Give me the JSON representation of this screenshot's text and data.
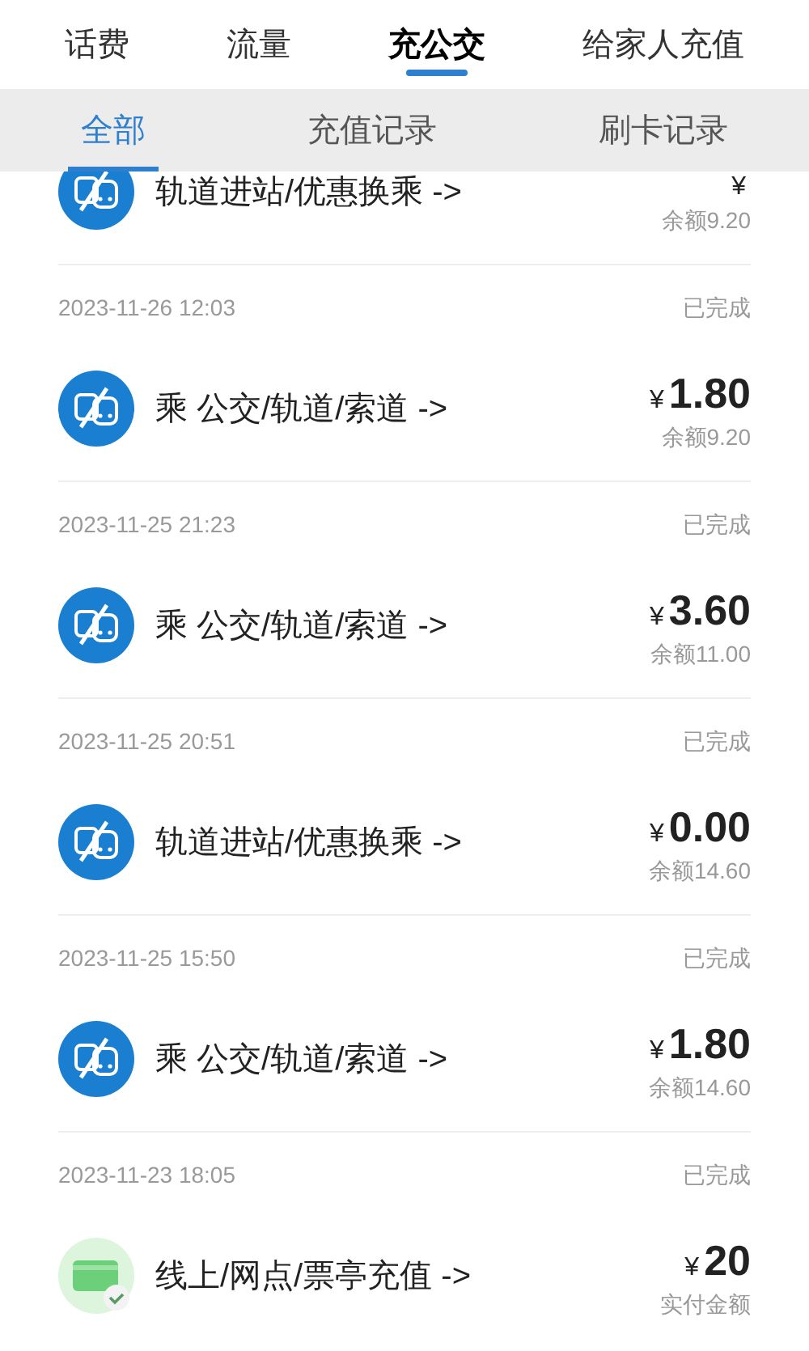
{
  "top_tabs": [
    {
      "label": "话费",
      "selected": false
    },
    {
      "label": "流量",
      "selected": false
    },
    {
      "label": "充公交",
      "selected": true
    },
    {
      "label": "给家人充值",
      "selected": false
    }
  ],
  "sub_tabs": [
    {
      "label": "全部",
      "selected": true
    },
    {
      "label": "充值记录",
      "selected": false
    },
    {
      "label": "刷卡记录",
      "selected": false
    }
  ],
  "records": [
    {
      "kind": "transit",
      "title": "轨道进站/优惠换乘 ->",
      "currency": "¥",
      "note": "余额9.20"
    },
    {
      "kind": "transit",
      "time": "2023-11-26 12:03",
      "status": "已完成",
      "title": "乘 公交/轨道/索道 ->",
      "currency": "¥",
      "amount": "1.80",
      "note": "余额9.20"
    },
    {
      "kind": "transit",
      "time": "2023-11-25 21:23",
      "status": "已完成",
      "title": "乘 公交/轨道/索道 ->",
      "currency": "¥",
      "amount": "3.60",
      "note": "余额11.00"
    },
    {
      "kind": "transit",
      "time": "2023-11-25 20:51",
      "status": "已完成",
      "title": "轨道进站/优惠换乘 ->",
      "currency": "¥",
      "amount": "0.00",
      "note": "余额14.60"
    },
    {
      "kind": "transit",
      "time": "2023-11-25 15:50",
      "status": "已完成",
      "title": "乘 公交/轨道/索道 ->",
      "currency": "¥",
      "amount": "1.80",
      "note": "余额14.60"
    },
    {
      "kind": "recharge",
      "time": "2023-11-23 18:05",
      "status": "已完成",
      "title": "线上/网点/票亭充值 ->",
      "currency": "¥",
      "amount": "20",
      "note": "实付金额"
    }
  ]
}
